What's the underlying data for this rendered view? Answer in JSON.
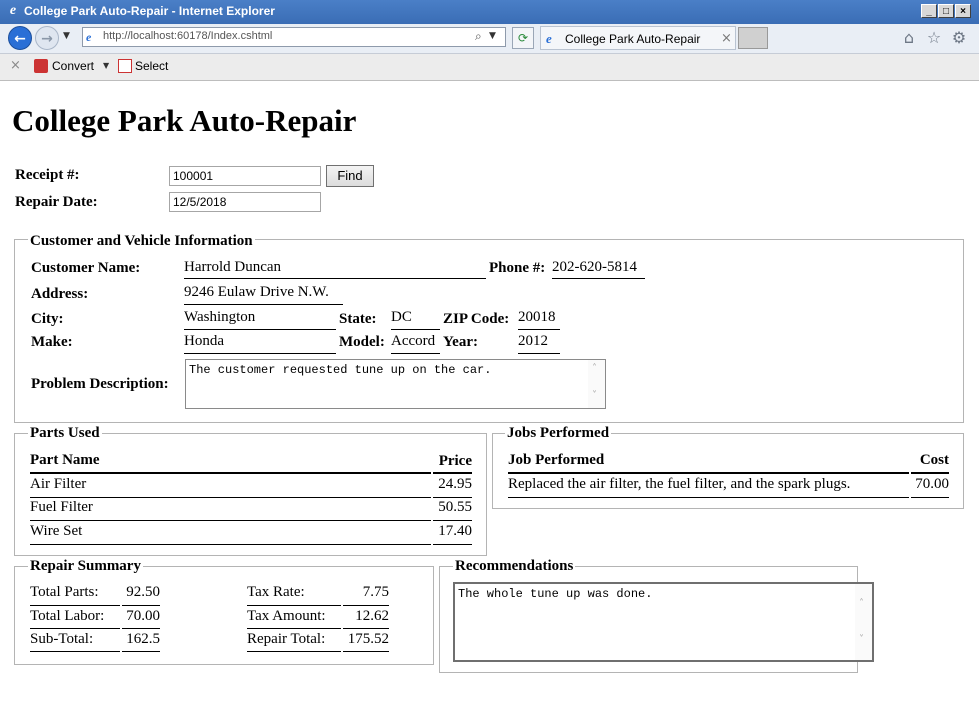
{
  "window": {
    "title": "College Park Auto-Repair - Internet Explorer",
    "min": "_",
    "max": "□",
    "close": "×"
  },
  "nav": {
    "url": "http://localhost:60178/Index.cshtml",
    "tab_title": "College Park Auto-Repair"
  },
  "commands": {
    "convert": "Convert",
    "select": "Select"
  },
  "page": {
    "heading": "College Park Auto-Repair",
    "receipt_label": "Receipt #:",
    "receipt_value": "100001",
    "find_label": "Find",
    "repair_date_label": "Repair Date:",
    "repair_date_value": "12/5/2018"
  },
  "customer": {
    "legend": "Customer and Vehicle Information",
    "name_label": "Customer Name:",
    "name": "Harrold Duncan",
    "phone_label": "Phone #:",
    "phone": "202-620-5814",
    "address_label": "Address:",
    "address": "9246 Eulaw Drive N.W.",
    "city_label": "City:",
    "city": "Washington",
    "state_label": "State:",
    "state": "DC",
    "zip_label": "ZIP Code:",
    "zip": "20018",
    "make_label": "Make:",
    "make": "Honda",
    "model_label": "Model:",
    "model": "Accord",
    "year_label": "Year:",
    "year": "2012",
    "problem_label": "Problem Description:",
    "problem": "The customer requested tune up on the car."
  },
  "parts": {
    "legend": "Parts Used",
    "col_name": "Part Name",
    "col_price": "Price",
    "rows": [
      {
        "name": "Air Filter",
        "price": "24.95"
      },
      {
        "name": "Fuel Filter",
        "price": "50.55"
      },
      {
        "name": "Wire Set",
        "price": "17.40"
      }
    ]
  },
  "jobs": {
    "legend": "Jobs Performed",
    "col_job": "Job Performed",
    "col_cost": "Cost",
    "rows": [
      {
        "job": "Replaced the air filter, the fuel filter, and the spark plugs.",
        "cost": "70.00"
      }
    ]
  },
  "summary": {
    "legend": "Repair Summary",
    "total_parts_label": "Total Parts:",
    "total_parts": "92.50",
    "total_labor_label": "Total Labor:",
    "total_labor": "70.00",
    "sub_total_label": "Sub-Total:",
    "sub_total": "162.5",
    "tax_rate_label": "Tax Rate:",
    "tax_rate": "7.75",
    "tax_amount_label": "Tax Amount:",
    "tax_amount": "12.62",
    "repair_total_label": "Repair Total:",
    "repair_total": "175.52"
  },
  "recommendations": {
    "legend": "Recommendations",
    "text": "The whole tune up was done."
  },
  "icons": {
    "home": "⌂",
    "star": "☆",
    "gear": "⚙"
  }
}
